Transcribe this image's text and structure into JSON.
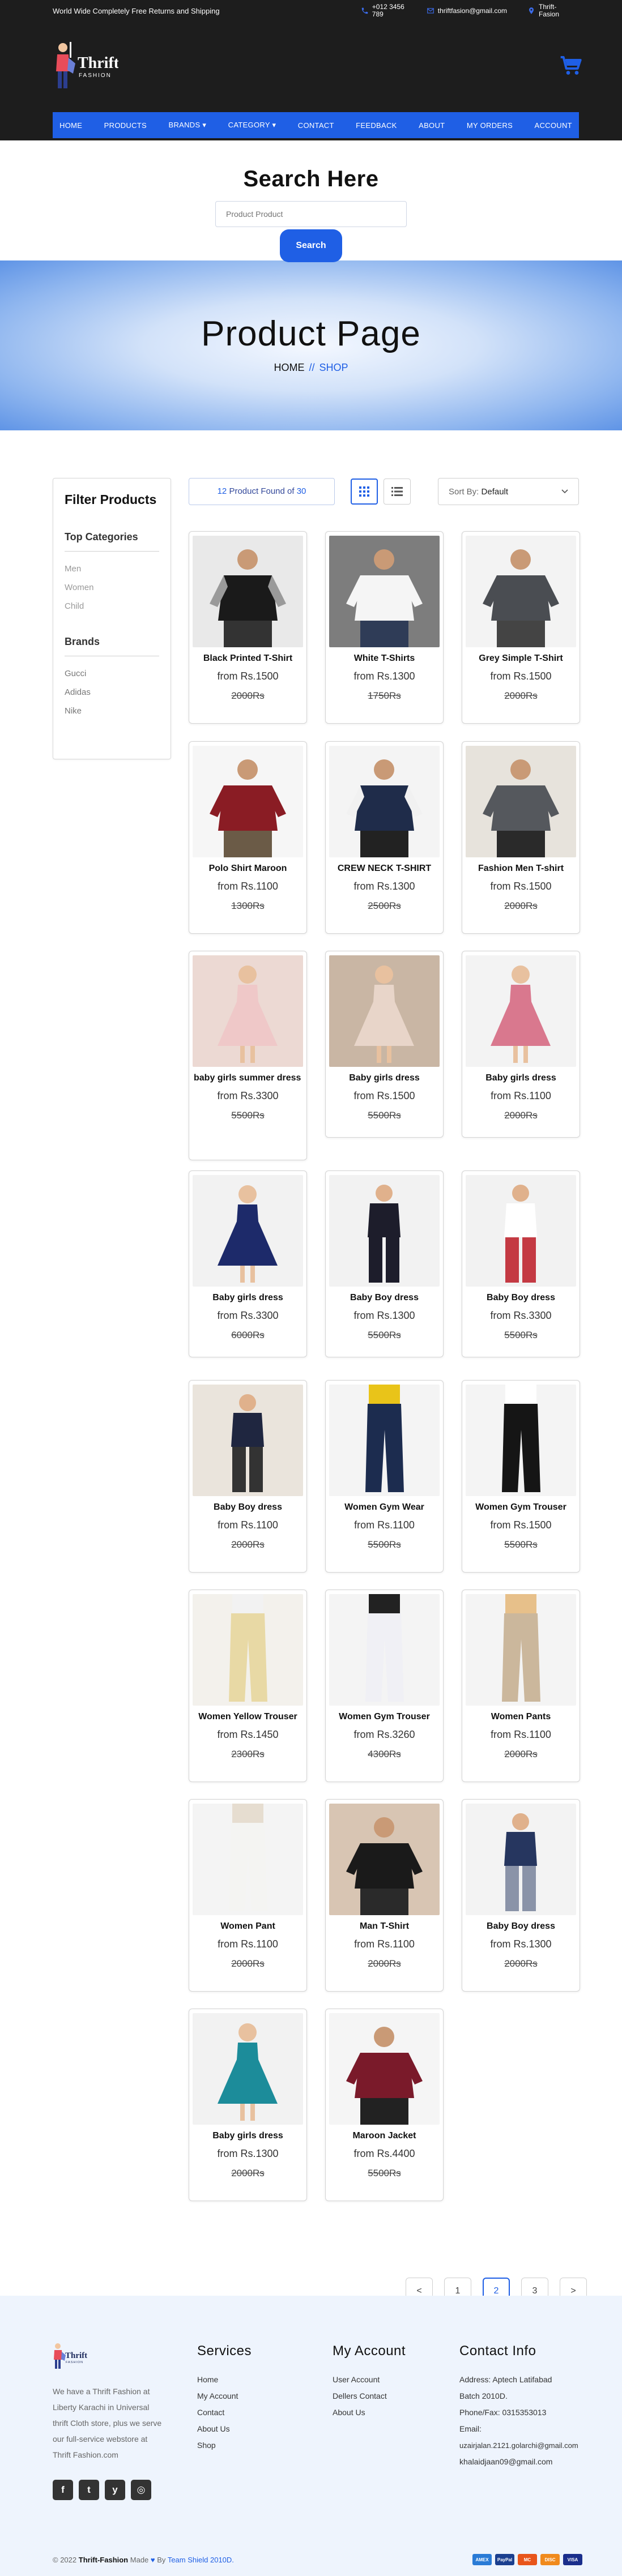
{
  "topbar": {
    "promo": "World Wide Completely Free Returns and Shipping",
    "phone": "+012 3456 789",
    "email": "thriftfasion@gmail.com",
    "store": "Thrift-Fasion"
  },
  "logo": {
    "line1": "Thrift",
    "line2": "FASHION"
  },
  "nav": [
    {
      "label": "HOME"
    },
    {
      "label": "PRODUCTS"
    },
    {
      "label": "BRANDS ▾"
    },
    {
      "label": "CATEGORY ▾"
    },
    {
      "label": "CONTACT"
    },
    {
      "label": "FEEDBACK"
    },
    {
      "label": "ABOUT"
    },
    {
      "label": "MY ORDERS"
    },
    {
      "label": "ACCOUNT"
    }
  ],
  "search": {
    "title": "Search Here",
    "placeholder": "Product Product",
    "button": "Search"
  },
  "banner": {
    "title": "Product Page",
    "home": "HOME",
    "sep": "//",
    "current": "SHOP"
  },
  "sidebar": {
    "title": "Filter Products",
    "categories_title": "Top Categories",
    "categories": [
      "Men",
      "Women",
      "Child"
    ],
    "brands_title": "Brands",
    "brands": [
      "Gucci",
      "Adidas",
      "Nike"
    ]
  },
  "toolbar": {
    "found_count": "12",
    "found_text": "Product Found of",
    "found_total": "30",
    "sort_label": "Sort By:",
    "sort_value": "Default"
  },
  "products": [
    {
      "name": "Black Printed T-Shirt",
      "price": "from Rs.1500",
      "old": "2000Rs"
    },
    {
      "name": "White T-Shirts",
      "price": "from Rs.1300",
      "old": "1750Rs"
    },
    {
      "name": "Grey Simple T-Shirt",
      "price": "from Rs.1500",
      "old": "2000Rs"
    },
    {
      "name": "Polo Shirt Maroon",
      "price": "from Rs.1100",
      "old": "1300Rs"
    },
    {
      "name": "CREW NECK T-SHIRT",
      "price": "from Rs.1300",
      "old": "2500Rs"
    },
    {
      "name": "Fashion Men T-shirt",
      "price": "from Rs.1500",
      "old": "2000Rs"
    },
    {
      "name": "baby girls summer dress",
      "price": "from Rs.3300",
      "old": "5500Rs"
    },
    {
      "name": "Baby girls dress",
      "price": "from Rs.1500",
      "old": "5500Rs"
    },
    {
      "name": "Baby girls dress",
      "price": "from Rs.1100",
      "old": "2000Rs"
    },
    {
      "name": "Baby girls dress",
      "price": "from Rs.3300",
      "old": "6000Rs"
    },
    {
      "name": "Baby Boy dress",
      "price": "from Rs.1300",
      "old": "5500Rs"
    },
    {
      "name": "Baby Boy dress",
      "price": "from Rs.3300",
      "old": "5500Rs"
    },
    {
      "name": "Baby Boy dress",
      "price": "from Rs.1100",
      "old": "2000Rs"
    },
    {
      "name": "Women Gym Wear",
      "price": "from Rs.1100",
      "old": "5500Rs"
    },
    {
      "name": "Women Gym Trouser",
      "price": "from Rs.1500",
      "old": "5500Rs"
    },
    {
      "name": "Women Yellow Trouser",
      "price": "from Rs.1450",
      "old": "2300Rs"
    },
    {
      "name": "Women Gym Trouser",
      "price": "from Rs.3260",
      "old": "4300Rs"
    },
    {
      "name": "Women Pants",
      "price": "from Rs.1100",
      "old": "2000Rs"
    },
    {
      "name": "Women Pant",
      "price": "from Rs.1100",
      "old": "2000Rs"
    },
    {
      "name": "Man T-Shirt",
      "price": "from Rs.1100",
      "old": "2000Rs"
    },
    {
      "name": "Baby Boy dress",
      "price": "from Rs.1300",
      "old": "2000Rs"
    },
    {
      "name": "Baby girls dress",
      "price": "from Rs.1300",
      "old": "2000Rs"
    },
    {
      "name": "Maroon Jacket",
      "price": "from Rs.4400",
      "old": "5500Rs"
    }
  ],
  "pagination": {
    "prev": "<",
    "pages": [
      "1",
      "2",
      "3"
    ],
    "next": ">"
  },
  "footer": {
    "about": "We have a Thrift Fashion at Liberty Karachi in Universal thrift Cloth store, plus we serve our full-service webstore at Thrift Fashion.com",
    "socials": [
      "f",
      "t",
      "y",
      "◎"
    ],
    "services_title": "Services",
    "services": [
      "Home",
      "My Account",
      "Contact",
      "About Us",
      "Shop"
    ],
    "account_title": "My Account",
    "account": [
      "User Account",
      "Dellers Contact",
      "About Us"
    ],
    "contact_title": "Contact Info",
    "contact": [
      "Address: Aptech Latifabad",
      "Batch 2010D.",
      "Phone/Fax: 0315353013",
      "Email:",
      "uzairjalan.2121.golarchi@gmail.com",
      "khalaidjaan09@gmail.com"
    ],
    "copy_year": "© 2022",
    "copy_brand": "Thrift-Fashion",
    "copy_made": "Made",
    "copy_by": "By",
    "copy_team": "Team Shield 2010D.",
    "pay": [
      "AMEX",
      "PayPal",
      "MC",
      "DISC",
      "VISA"
    ],
    "pay_colors": [
      "#2a7bd6",
      "#1b3f8f",
      "#e8551b",
      "#f08a1d",
      "#1a2e8c"
    ]
  }
}
